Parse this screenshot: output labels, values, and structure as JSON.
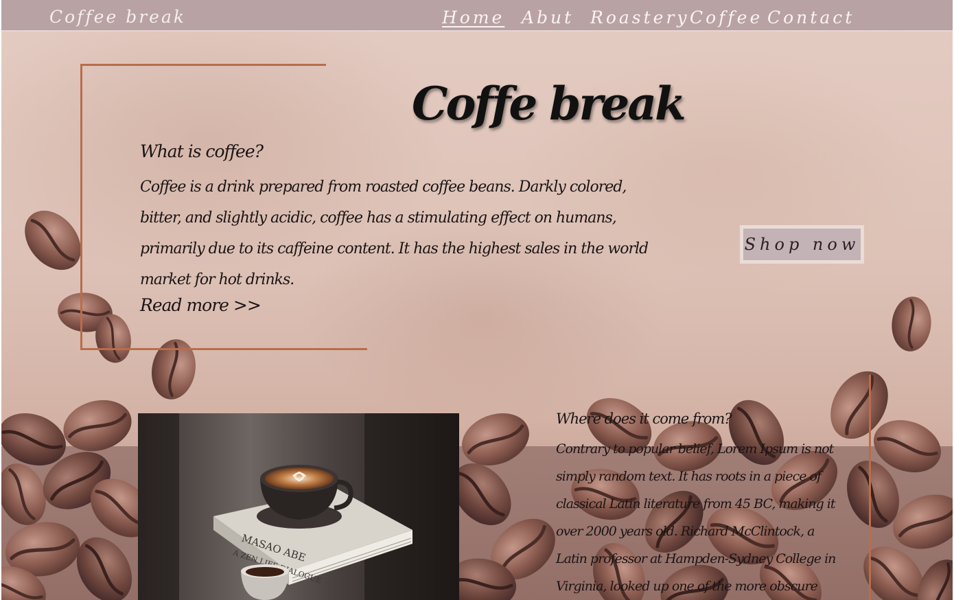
{
  "nav": {
    "brand": "Coffee break",
    "links": [
      {
        "label": "Home",
        "active": true
      },
      {
        "label": "Abut",
        "active": false
      },
      {
        "label": "Roastery",
        "active": false
      },
      {
        "label": "Coffee",
        "active": false
      },
      {
        "label": "Contact",
        "active": false
      }
    ]
  },
  "hero": {
    "title": "Coffe break",
    "question": "What is coffee?",
    "body": "Coffee is a drink prepared from roasted coffee beans. Darkly colored, bitter, and slightly acidic, coffee has a stimulating effect on humans, primarily due to its caffeine content. It has the highest sales in the world market for hot drinks.",
    "read_more": "Read more >>",
    "shop_button": "Shop now"
  },
  "origin": {
    "question": "Where does it come from?",
    "body": "Contrary to popular belief, Lorem Ipsum is not simply random text. It has roots in a piece of classical Latin literature from 45 BC, making it over 2000 years old. Richard McClintock, a Latin professor at Hampden-Sydney College in Virginia, looked up one of the more obscure Latin"
  },
  "photo": {
    "book_title": "MASAO ABE",
    "book_subtitle": "A ZEN LIFE DIALOGUE"
  },
  "colors": {
    "nav_bg": "#b8a2a3",
    "frame_accent": "#b86d4b",
    "bean": "#8a5a4e",
    "button_bg": "#c3b3b6"
  }
}
